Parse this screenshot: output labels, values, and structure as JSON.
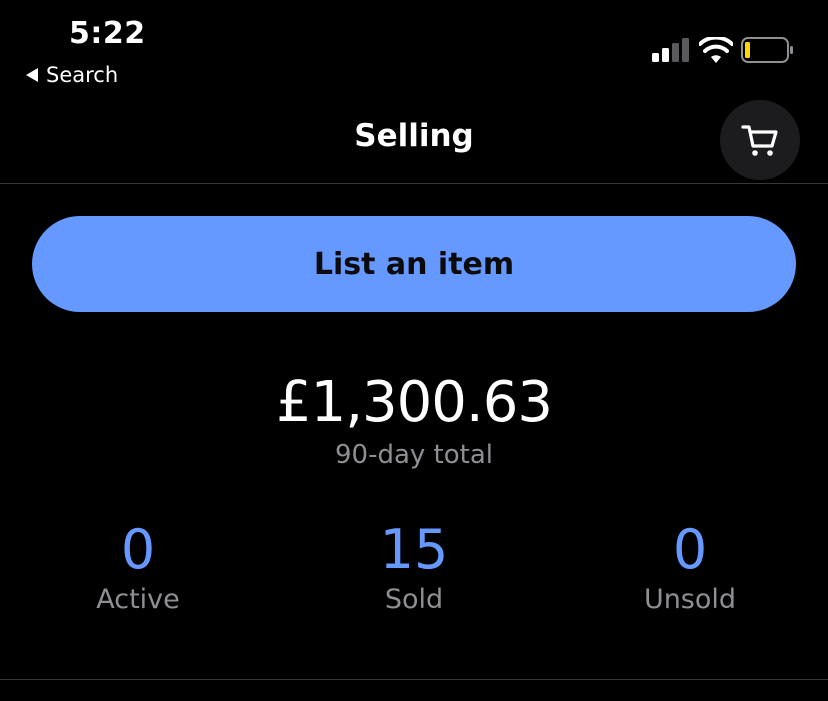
{
  "status_bar": {
    "time": "5:22",
    "back_label": "Search",
    "battery_color": "#ffd60a"
  },
  "header": {
    "title": "Selling",
    "cart_icon": "cart-icon"
  },
  "actions": {
    "list_item_label": "List an item"
  },
  "summary": {
    "total_amount": "£1,300.63",
    "total_caption": "90-day total"
  },
  "stats": [
    {
      "count": "0",
      "label": "Active"
    },
    {
      "count": "15",
      "label": "Sold"
    },
    {
      "count": "0",
      "label": "Unsold"
    }
  ],
  "colors": {
    "accent": "#6599ff",
    "background": "#000000",
    "muted_text": "#8e8e93"
  }
}
